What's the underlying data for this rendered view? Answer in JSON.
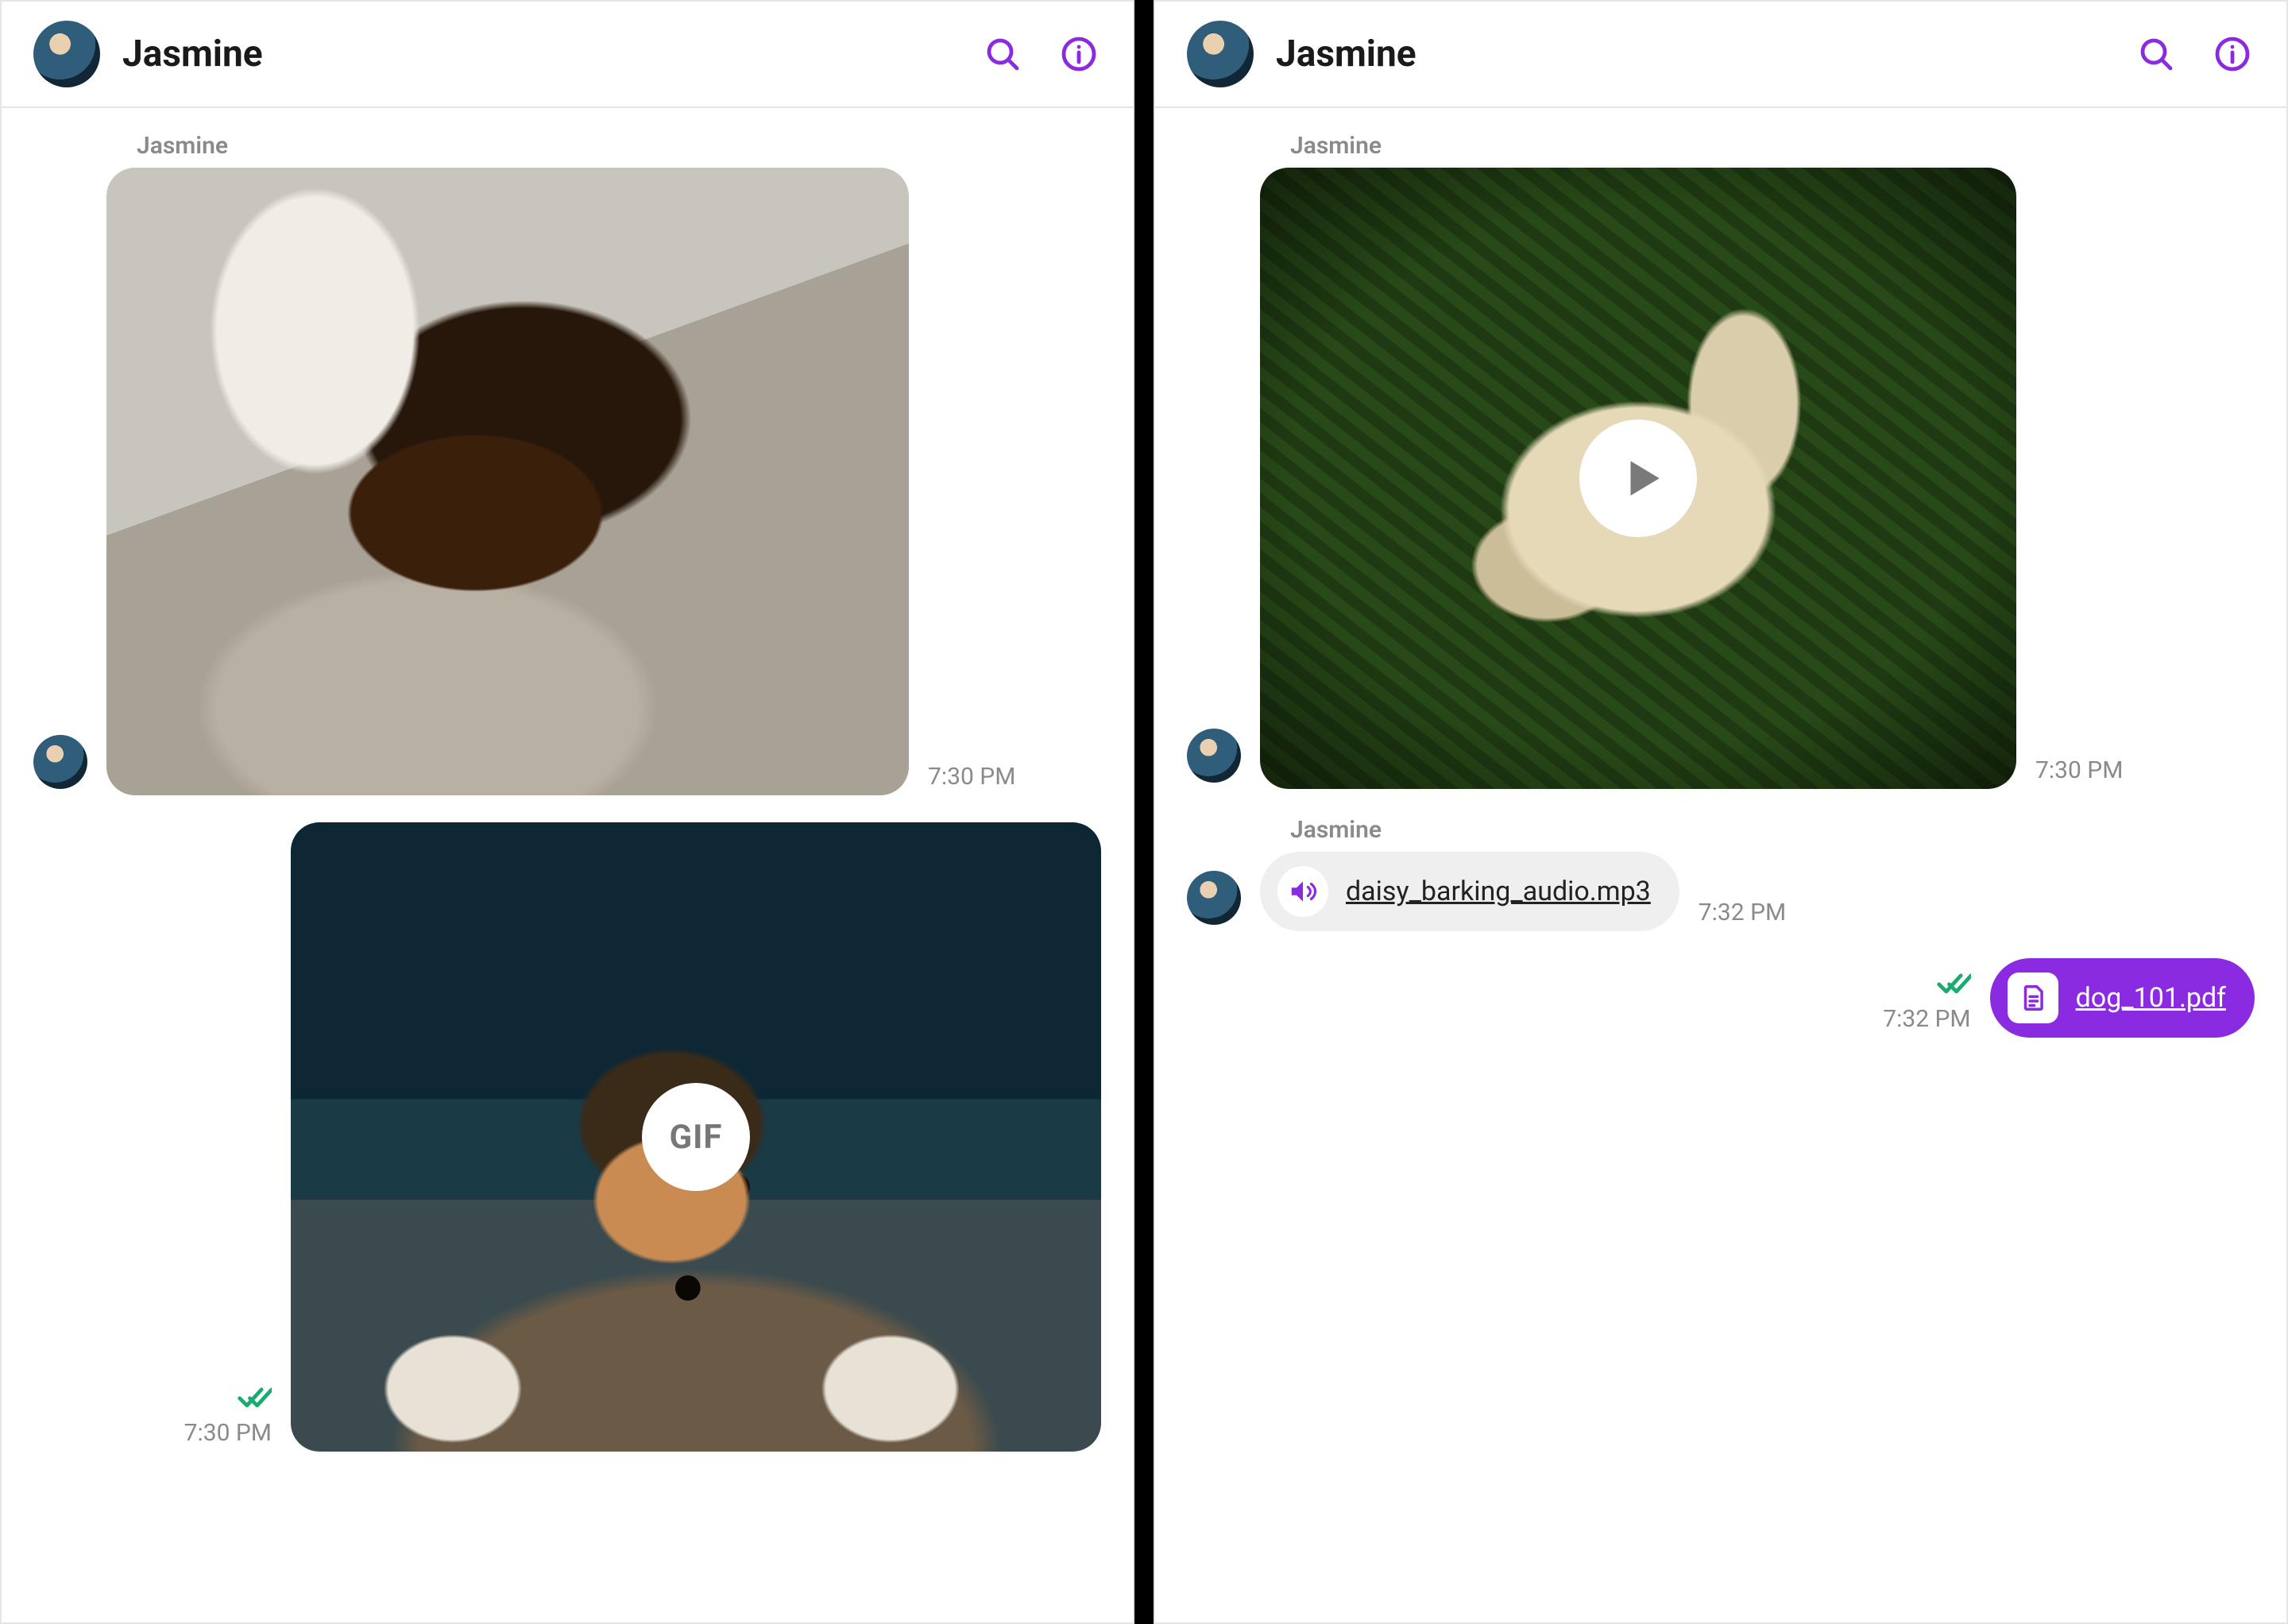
{
  "colors": {
    "accent": "#8a2be2",
    "read_check": "#1aab6e"
  },
  "left": {
    "header": {
      "contact_name": "Jasmine"
    },
    "messages": [
      {
        "sender": "Jasmine",
        "type": "image",
        "timestamp": "7:30 PM"
      },
      {
        "sender": "me",
        "type": "gif",
        "badge": "GIF",
        "timestamp": "7:30 PM",
        "read": true
      }
    ]
  },
  "right": {
    "header": {
      "contact_name": "Jasmine"
    },
    "messages": [
      {
        "sender": "Jasmine",
        "type": "video",
        "timestamp": "7:30 PM"
      },
      {
        "sender": "Jasmine",
        "type": "audio",
        "filename": "daisy_barking_audio.mp3",
        "timestamp": "7:32 PM"
      },
      {
        "sender": "me",
        "type": "file",
        "filename": "dog_101.pdf",
        "timestamp": "7:32 PM",
        "read": true
      }
    ]
  }
}
